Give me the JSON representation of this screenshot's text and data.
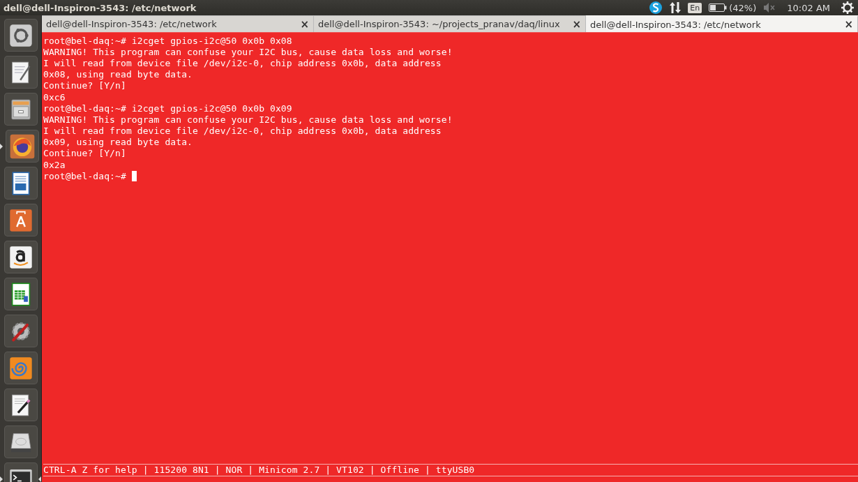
{
  "top_bar": {
    "title": "dell@dell-Inspiron-3543: /etc/network",
    "keyboard": "En",
    "battery": {
      "reading": "(42%)",
      "level": 0.42
    },
    "sound": {
      "muted": true
    },
    "clock": "10:02 AM"
  },
  "launcher": [
    {
      "kind": "ubuntu",
      "running": false,
      "focused": false
    },
    {
      "kind": "notes",
      "running": false,
      "focused": false
    },
    {
      "kind": "cabinet",
      "running": false,
      "focused": false
    },
    {
      "kind": "firefox",
      "running": true,
      "focused": false
    },
    {
      "kind": "writer",
      "running": false,
      "focused": false
    },
    {
      "kind": "bag",
      "running": false,
      "focused": false
    },
    {
      "kind": "amazon",
      "running": false,
      "focused": false
    },
    {
      "kind": "calc",
      "running": false,
      "focused": false
    },
    {
      "kind": "tools",
      "running": false,
      "focused": false
    },
    {
      "kind": "swirl",
      "running": false,
      "focused": false
    },
    {
      "kind": "editor",
      "running": false,
      "focused": false
    },
    {
      "kind": "drive",
      "running": false,
      "focused": false
    },
    {
      "kind": "terminal",
      "running": true,
      "focused": true
    }
  ],
  "tabs": [
    {
      "label": "dell@dell-Inspiron-3543: /etc/network",
      "close": "×",
      "selected": false
    },
    {
      "label": "dell@dell-Inspiron-3543: ~/projects_pranav/daq/linux",
      "close": "×",
      "selected": false
    },
    {
      "label": "dell@dell-Inspiron-3543: /etc/network",
      "close": "×",
      "selected": true
    }
  ],
  "terminal": {
    "lines": [
      "root@bel-daq:~# i2cget gpios-i2c@50 0x0b 0x08",
      "WARNING! This program can confuse your I2C bus, cause data loss and worse!",
      "I will read from device file /dev/i2c-0, chip address 0x0b, data address",
      "0x08, using read byte data.",
      "Continue? [Y/n]",
      "0xc6",
      "root@bel-daq:~# i2cget gpios-i2c@50 0x0b 0x09",
      "WARNING! This program can confuse your I2C bus, cause data loss and worse!",
      "I will read from device file /dev/i2c-0, chip address 0x0b, data address",
      "0x09, using read byte data.",
      "Continue? [Y/n]",
      "0x2a",
      "root@bel-daq:~# "
    ],
    "status_line": "CTRL-A Z for help | 115200 8N1 | NOR | Minicom 2.7 | VT102 | Offline | ttyUSB0"
  }
}
